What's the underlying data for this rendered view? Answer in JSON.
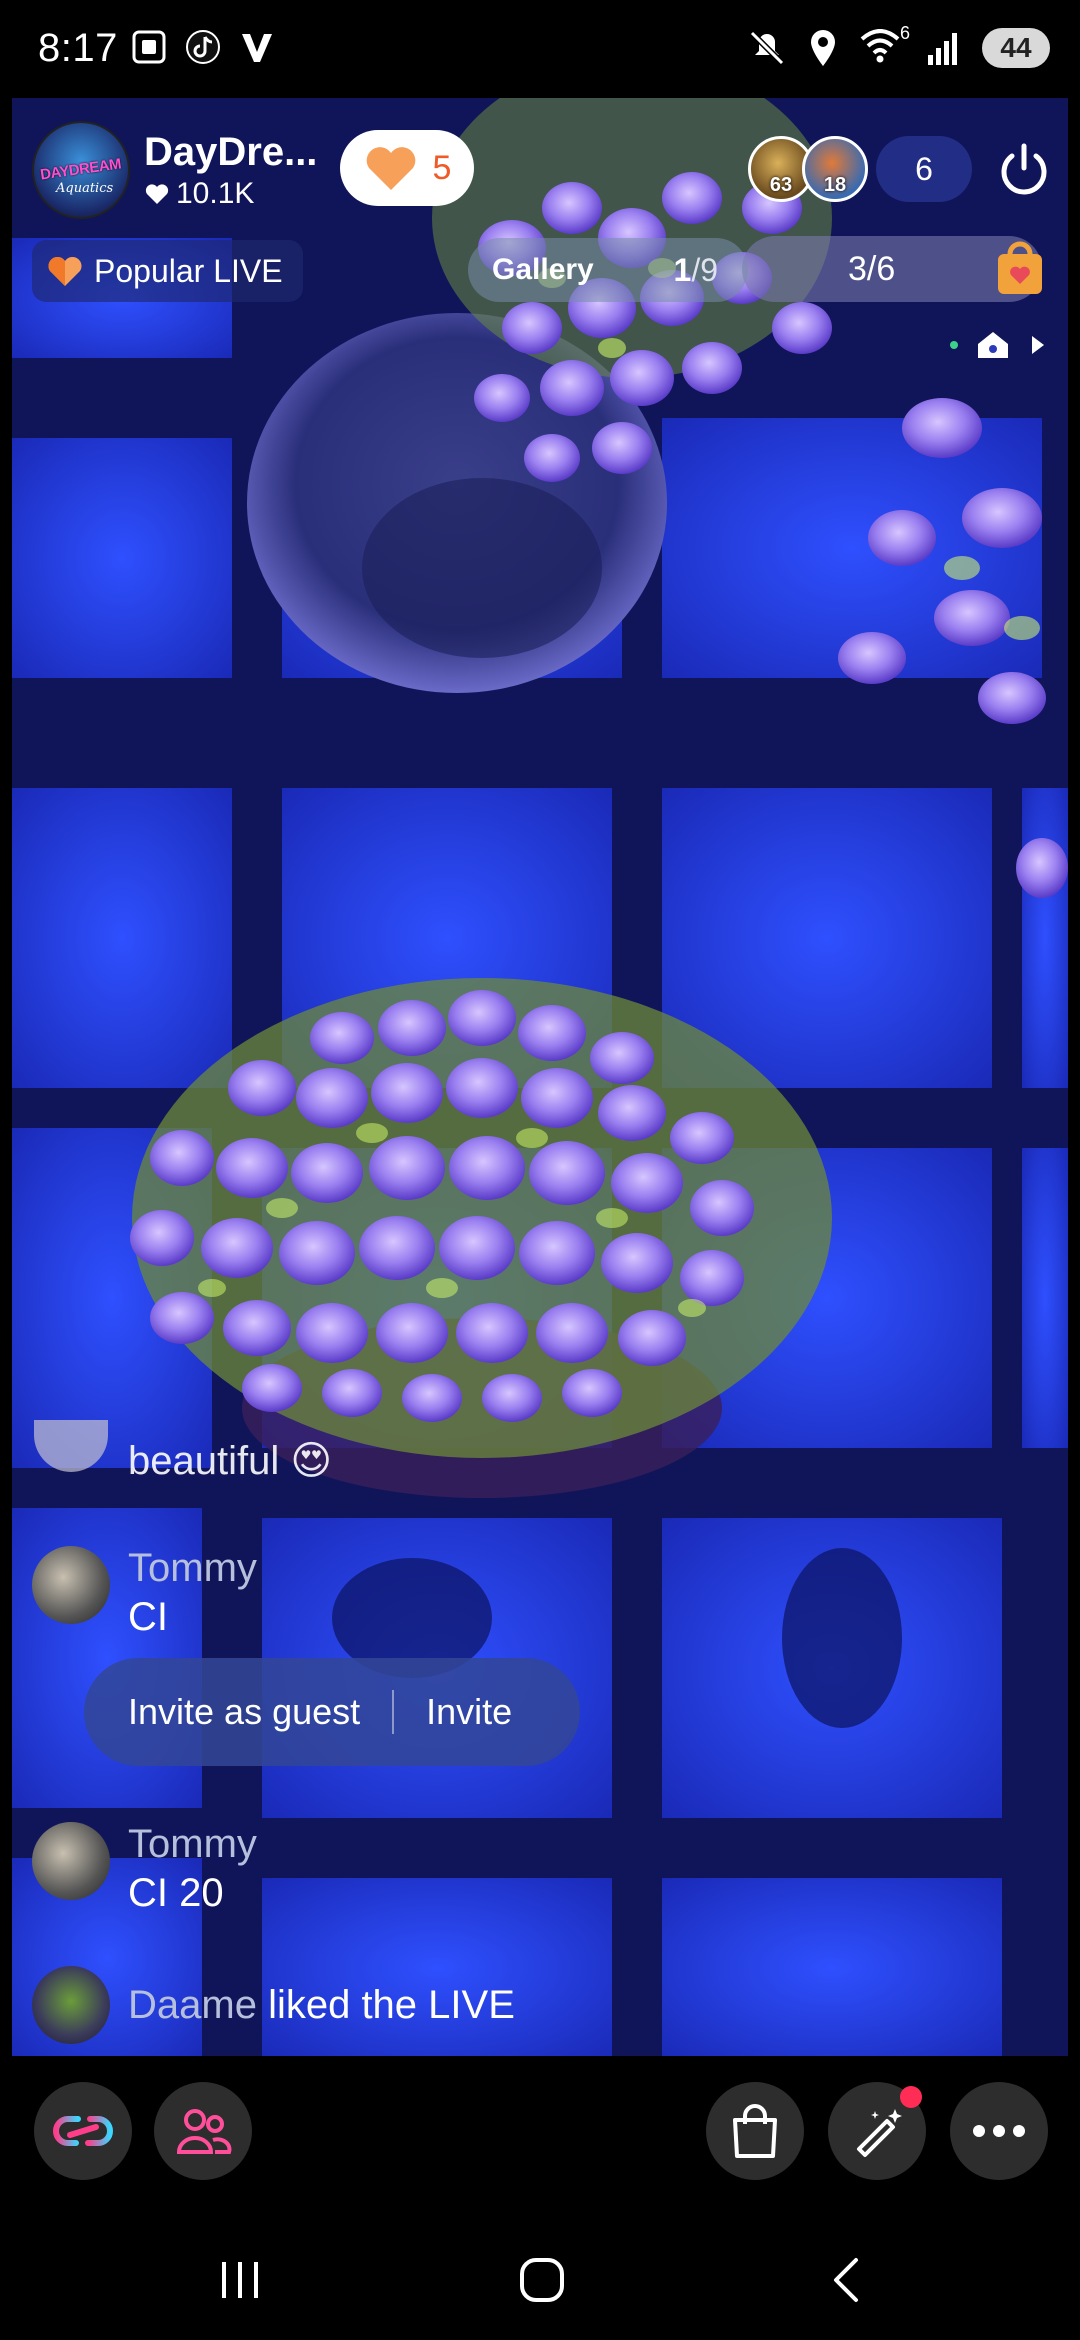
{
  "status_bar": {
    "time": "8:17",
    "left_icons": [
      "screenshot-icon",
      "tiktok-icon",
      "v-app-icon"
    ],
    "right_icons": [
      "mute-icon",
      "location-icon",
      "wifi-icon",
      "signal-icon"
    ],
    "wifi_label": "6",
    "battery": "44"
  },
  "host": {
    "name": "DayDre...",
    "likes": "10.1K",
    "avatar_logo": "DAYDREAM",
    "avatar_logo_sub": "Aquatics"
  },
  "like_button": {
    "count": "5"
  },
  "viewers": {
    "avatars": [
      {
        "number": "63",
        "color": "#8a6a2e"
      },
      {
        "number": "18",
        "color": "#5a7fb0"
      }
    ],
    "count": "6"
  },
  "popular_live": {
    "label": "Popular LIVE"
  },
  "gallery": {
    "label": "Gallery",
    "current": "1",
    "total": "/9"
  },
  "gift_progress": {
    "text": "3/6"
  },
  "comments": [
    {
      "user": "",
      "text": "beautiful 😍"
    },
    {
      "user": "Tommy",
      "text": "CI"
    },
    {
      "user": "Tommy",
      "text": "CI 20"
    }
  ],
  "invite": {
    "guest_label": "Invite as guest",
    "invite_label": "Invite"
  },
  "liked_event": {
    "user": "Daame",
    "text": " liked the LIVE"
  },
  "toolbar": {
    "left": [
      "link-icon",
      "guests-icon"
    ],
    "right": [
      "shopping-bag-icon",
      "magic-wand-icon",
      "more-icon"
    ]
  },
  "nav": [
    "recent-apps-icon",
    "home-icon",
    "back-icon"
  ],
  "colors": {
    "accent_orange": "#f05a28",
    "chip_blue": "#283796",
    "notif_red": "#ff2d55"
  }
}
